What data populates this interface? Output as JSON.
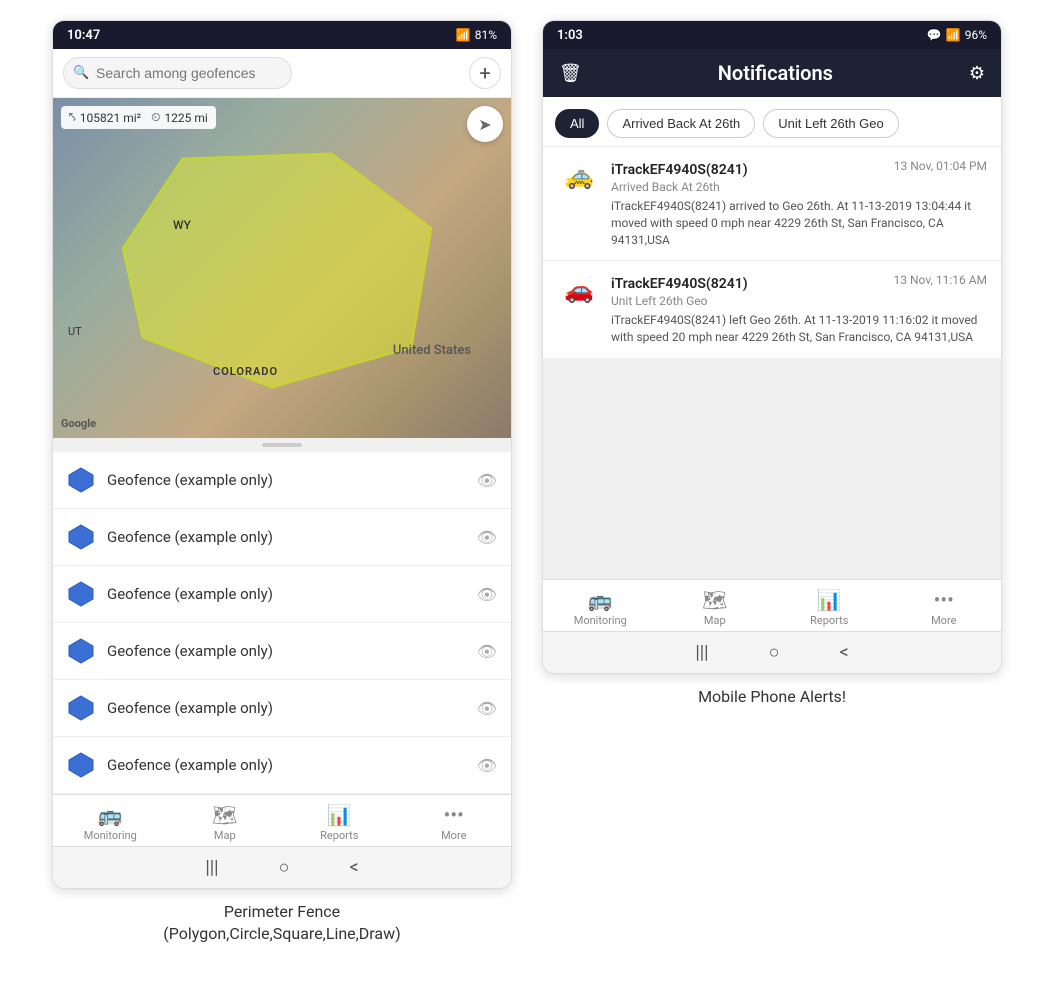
{
  "left_phone": {
    "status_bar": {
      "time": "10:47",
      "wifi": "WiFi",
      "signal": "4G",
      "battery": "81%"
    },
    "search_placeholder": "Search among geofences",
    "map": {
      "stat1_area": "105821 mi²",
      "stat1_dist": "1225 mi",
      "label_wy": "WY",
      "label_ut": "UT",
      "label_co": "COLORADO",
      "label_us": "United States",
      "google": "Google"
    },
    "geofences": [
      {
        "name": "Geofence (example only)"
      },
      {
        "name": "Geofence (example only)"
      },
      {
        "name": "Geofence (example only)"
      },
      {
        "name": "Geofence (example only)"
      },
      {
        "name": "Geofence (example only)"
      },
      {
        "name": "Geofence (example only)"
      }
    ],
    "nav": [
      {
        "label": "Monitoring",
        "icon": "🚌"
      },
      {
        "label": "Map",
        "icon": "🗺"
      },
      {
        "label": "Reports",
        "icon": "📊"
      },
      {
        "label": "More",
        "icon": "···"
      }
    ],
    "android_nav": [
      "|||",
      "○",
      "<"
    ]
  },
  "right_phone": {
    "status_bar": {
      "time": "1:03",
      "chat": "💬",
      "wifi": "WiFi",
      "signal": "4G",
      "battery": "96%"
    },
    "header": {
      "title": "Notifications",
      "delete_icon": "🗑",
      "settings_icon": "⚙"
    },
    "filters": [
      {
        "label": "All",
        "active": true
      },
      {
        "label": "Arrived Back At 26th",
        "active": false
      },
      {
        "label": "Unit Left 26th Geo",
        "active": false
      }
    ],
    "notifications": [
      {
        "device": "iTrackEF4940S(8241)",
        "time": "13 Nov, 01:04 PM",
        "type": "Arrived Back At 26th",
        "body": "iTrackEF4940S(8241) arrived to Geo 26th.   At 11-13-2019 13:04:44 it moved with speed 0 mph near 4229 26th St, San Francisco, CA 94131,USA",
        "car_emoji": "🚕"
      },
      {
        "device": "iTrackEF4940S(8241)",
        "time": "13 Nov, 11:16 AM",
        "type": "Unit Left 26th Geo",
        "body": "iTrackEF4940S(8241) left Geo 26th.  At 11-13-2019 11:16:02 it moved with speed 20 mph near 4229 26th St, San Francisco, CA 94131,USA",
        "car_emoji": "🚗"
      }
    ],
    "nav": [
      {
        "label": "Monitoring",
        "icon": "🚌"
      },
      {
        "label": "Map",
        "icon": "🗺"
      },
      {
        "label": "Reports",
        "icon": "📊"
      },
      {
        "label": "More",
        "icon": "···"
      }
    ],
    "android_nav": [
      "|||",
      "○",
      "<"
    ]
  },
  "captions": {
    "left": "Perimeter Fence\n(Polygon,Circle,Square,Line,Draw)",
    "right": "Mobile Phone Alerts!"
  }
}
